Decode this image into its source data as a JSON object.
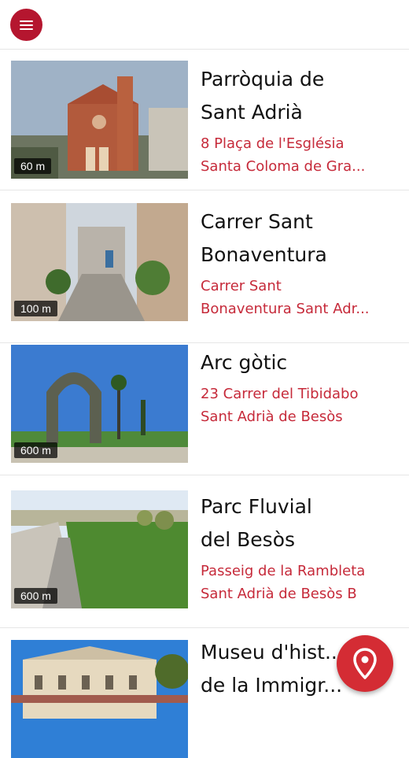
{
  "header": {
    "menu_icon": "hamburger-menu-icon"
  },
  "places": [
    {
      "title_line1": "Parròquia de",
      "title_line2": "Sant Adrià",
      "addr_line1": "8 Plaça de l'Església",
      "addr_line2": "Santa Coloma de Gra...",
      "distance": "60 m"
    },
    {
      "title_line1": "Carrer Sant",
      "title_line2": "Bonaventura",
      "addr_line1": "Carrer Sant",
      "addr_line2": "Bonaventura Sant Adr...",
      "distance": "100 m"
    },
    {
      "title_line1": "Arc gòtic",
      "title_line2": "",
      "addr_line1": "23 Carrer del Tibidabo",
      "addr_line2": "Sant Adrià de Besòs",
      "distance": "600 m"
    },
    {
      "title_line1": "Parc Fluvial",
      "title_line2": "del Besòs",
      "addr_line1": "Passeig de la Rambleta",
      "addr_line2": "Sant Adrià de Besòs B",
      "distance": "600 m"
    },
    {
      "title_line1": "Museu d'hist...",
      "title_line2": "de la Immigr...",
      "addr_line1": "",
      "addr_line2": "",
      "distance": ""
    }
  ],
  "fab": {
    "icon": "map-pin-icon"
  },
  "colors": {
    "accent": "#b5162f",
    "address": "#c62a3a",
    "fab": "#d42c34"
  }
}
